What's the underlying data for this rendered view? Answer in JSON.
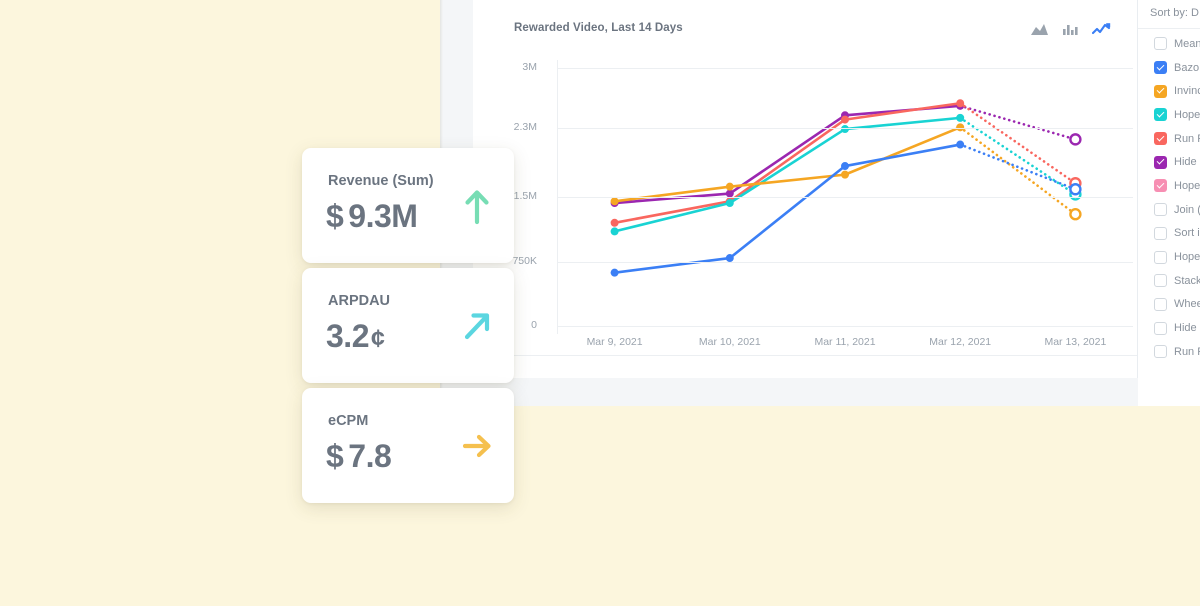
{
  "chart_panel": {
    "title": "Rewarded Video, Last 14 Days",
    "type_toggles": [
      {
        "name": "area-chart-toggle",
        "icon": "area-chart-icon",
        "active": false
      },
      {
        "name": "bar-chart-toggle",
        "icon": "bar-chart-icon",
        "active": false
      },
      {
        "name": "line-chart-toggle",
        "icon": "line-chart-icon",
        "active": true
      }
    ]
  },
  "legend_sidebar": {
    "sort_by": "Sort by: D",
    "items": [
      {
        "label": "Mean",
        "checked": false,
        "color": "#ffffff"
      },
      {
        "label": "Bazo",
        "checked": true,
        "color": "#3b7ff5"
      },
      {
        "label": "Invinc",
        "checked": true,
        "color": "#f5a623"
      },
      {
        "label": "Hope",
        "checked": true,
        "color": "#19d3d3"
      },
      {
        "label": "Run F",
        "checked": true,
        "color": "#f9675f"
      },
      {
        "label": "Hide",
        "checked": true,
        "color": "#9b27b0"
      },
      {
        "label": "Hope",
        "checked": true,
        "color": "#f78fb3"
      },
      {
        "label": "Join (",
        "checked": false,
        "color": "#ffffff"
      },
      {
        "label": "Sort i",
        "checked": false,
        "color": "#ffffff"
      },
      {
        "label": "Hope",
        "checked": false,
        "color": "#ffffff"
      },
      {
        "label": "Stack",
        "checked": false,
        "color": "#ffffff"
      },
      {
        "label": "Whee",
        "checked": false,
        "color": "#ffffff"
      },
      {
        "label": "Hide",
        "checked": false,
        "color": "#ffffff"
      },
      {
        "label": "Run F",
        "checked": false,
        "color": "#ffffff"
      }
    ]
  },
  "kpi_cards": [
    {
      "name": "revenue",
      "label": "Revenue (Sum)",
      "currency": "$",
      "value": "9.3M",
      "unit": "",
      "trend": "up",
      "trend_color": "#77ddb4"
    },
    {
      "name": "arpdau",
      "label": "ARPDAU",
      "currency": "",
      "value": "3.2",
      "unit": "¢",
      "trend": "up-right",
      "trend_color": "#5bd6e0"
    },
    {
      "name": "ecpm",
      "label": "eCPM",
      "currency": "$",
      "value": "7.8",
      "unit": "",
      "trend": "right",
      "trend_color": "#f5c04e"
    }
  ],
  "chart_data": {
    "type": "line",
    "title": "Rewarded Video, Last 14 Days",
    "xlabel": "",
    "ylabel": "",
    "grid": true,
    "legend_position": "right",
    "x": [
      "Mar 9, 2021",
      "Mar 10, 2021",
      "Mar 11, 2021",
      "Mar 12, 2021",
      "Mar 13, 2021"
    ],
    "ytick_labels": [
      "0",
      "750K",
      "1.5M",
      "2.3M",
      "3M"
    ],
    "ytick_values": [
      0,
      750000,
      1500000,
      2300000,
      3000000
    ],
    "ylim": [
      0,
      3000000
    ],
    "forecast_from_index": 3,
    "forecast_style": "dotted-hollow-marker",
    "series": [
      {
        "name": "Hide",
        "color": "#9b27b0",
        "values": [
          1430000,
          1540000,
          2450000,
          2560000,
          2170000
        ]
      },
      {
        "name": "Run F",
        "color": "#f9675f",
        "values": [
          1200000,
          1450000,
          2400000,
          2590000,
          1660000
        ]
      },
      {
        "name": "Hope",
        "color": "#19d3d3",
        "values": [
          1100000,
          1430000,
          2290000,
          2420000,
          1530000
        ]
      },
      {
        "name": "Invinc",
        "color": "#f5a623",
        "values": [
          1450000,
          1620000,
          1760000,
          2310000,
          1300000
        ]
      },
      {
        "name": "Bazo",
        "color": "#3b7ff5",
        "values": [
          620000,
          790000,
          1860000,
          2110000,
          1590000
        ]
      }
    ]
  }
}
